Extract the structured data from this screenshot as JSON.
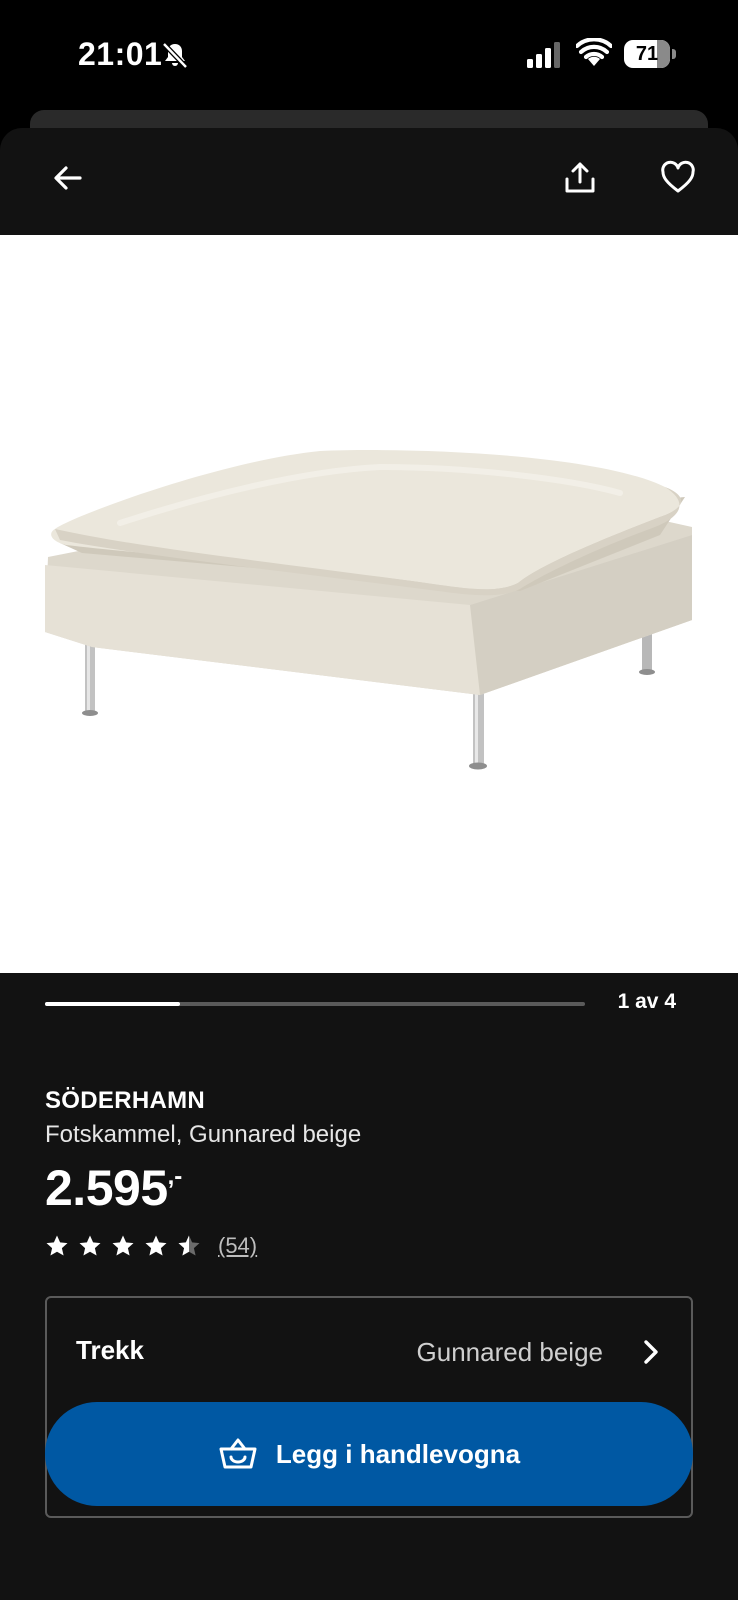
{
  "status_bar": {
    "time": "21:01",
    "battery_level": "71",
    "icons": [
      "bell-off-icon",
      "signal-icon",
      "wifi-icon",
      "battery-icon"
    ]
  },
  "nav": {
    "icons": [
      "arrow-left-icon",
      "share-icon",
      "heart-icon"
    ]
  },
  "carousel": {
    "counter": "1 av 4",
    "progress": 0.25
  },
  "product": {
    "name": "SÖDERHAMN",
    "description": "Fotskammel, Gunnared beige",
    "price_int": "2.595",
    "price_suffix": ",-",
    "rating": 4.5,
    "review_count": "(54)"
  },
  "variant": {
    "label": "Trekk",
    "value": "Gunnared beige"
  },
  "cart_button": {
    "label": "Legg i handlevogna"
  },
  "colors": {
    "background": "#121212",
    "accent_blue": "#0058a3",
    "text": "#ffffff",
    "muted_text": "#cfcfcf"
  }
}
